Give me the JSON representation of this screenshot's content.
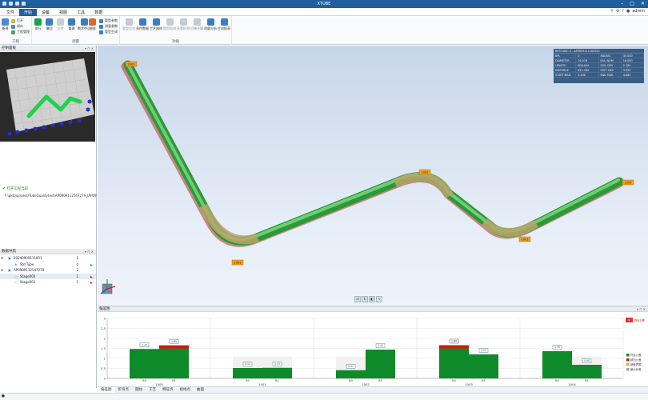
{
  "titlebar": {
    "title": "XTUBE"
  },
  "menu": {
    "tabs": [
      "文件",
      "开始",
      "设备",
      "视图",
      "工具",
      "数据"
    ],
    "active_index": 1,
    "user": "admin"
  },
  "ribbon": {
    "groups": [
      {
        "label": "工程"
      },
      {
        "label": "测量"
      },
      {
        "label": "功能"
      }
    ],
    "project": {
      "new": "新建",
      "open": "打开",
      "save": "保存",
      "manage": "工程管理"
    },
    "measure": {
      "run": "执行",
      "back": "撤回",
      "reverse": "反转",
      "rebuild": "重建",
      "fit_center": "数字中心",
      "view": "视图",
      "small": [
        "管型参数",
        "测量参数",
        "管型生成"
      ]
    },
    "functions": [
      "管型比对",
      "多件数据",
      "工艺路线",
      "管型检测",
      "多管检测",
      "回弹计算",
      "测量分析",
      "生成报表"
    ]
  },
  "left": {
    "preview_header": "控制面板",
    "project_name": "打开工程当前",
    "project_path": "F:\\pktp\\project\\TubeQualitytest\\AP0909112547279_IAP09",
    "tree_header": "数据导航",
    "tree": [
      {
        "label": "20240909111851",
        "count": "1",
        "level": 0,
        "icon": "folder-icon"
      },
      {
        "label": "Std Tube",
        "count": "0",
        "level": 1,
        "icon": "star-icon"
      },
      {
        "label": "AP0909112547279",
        "count": "2",
        "level": 0,
        "icon": "folder-icon"
      },
      {
        "label": "Stage000",
        "count": "1",
        "level": 1,
        "icon": "circle-icon"
      },
      {
        "label": "Stage001",
        "count": "1",
        "level": 1,
        "icon": "circle-icon"
      }
    ]
  },
  "viewport": {
    "labels": [
      "1000",
      "1001",
      "1002",
      "1003",
      "1004"
    ],
    "info": {
      "header": "BESTURE: 0 - AP0909111100912",
      "rows": [
        [
          "BPL",
          "0",
          "RADIUS",
          "30.000"
        ],
        [
          "DIAMETER",
          "16.078",
          "DIA. NOM",
          "16.000"
        ],
        [
          "LENGTH",
          "808.094",
          "LEN. DEV",
          "2.169"
        ],
        [
          "DISTANCE",
          "841.444",
          "DIST. DEV",
          "3.990"
        ],
        [
          "START MAR.",
          "1.406",
          "END MAR.",
          "4.682"
        ]
      ]
    }
  },
  "bottom": {
    "header": "偏差图",
    "legend": [
      "符合公差",
      "超出公差",
      "超差界限",
      "最大步差"
    ],
    "tabs": [
      "偏差图",
      "折弯点",
      "圆柱",
      "工艺",
      "特征点",
      "视线点",
      "曲面"
    ],
    "active_tab": 0
  },
  "chart_data": {
    "type": "bar",
    "yticks": [
      "3",
      "2.5",
      "2",
      "1.5",
      "1",
      "0.5",
      "0"
    ],
    "ylim": [
      0,
      3
    ],
    "groups": [
      {
        "name": "1000",
        "bars": [
          {
            "label": "B0",
            "value": 1.47,
            "text": "1.47",
            "exceed": 0
          },
          {
            "label": "B1",
            "value": 1.5,
            "text": "1.81",
            "exceed": 0.31
          }
        ]
      },
      {
        "name": "1001",
        "bars": [
          {
            "label": "B0",
            "value": 0.52,
            "text": "0.52",
            "exceed": 0
          },
          {
            "label": "B1",
            "value": 0.53,
            "text": "0.53",
            "exceed": 0
          }
        ]
      },
      {
        "name": "1002",
        "bars": [
          {
            "label": "B0",
            "value": 0.41,
            "text": "0.41",
            "exceed": 0
          },
          {
            "label": "B1",
            "value": 1.44,
            "text": "1.44",
            "exceed": 0
          }
        ]
      },
      {
        "name": "1003",
        "bars": [
          {
            "label": "B0",
            "value": 1.5,
            "text": "1.82",
            "exceed": 0.32
          },
          {
            "label": "B1",
            "value": 1.2,
            "text": "1.20",
            "exceed": 0
          }
        ]
      },
      {
        "name": "1004",
        "bars": [
          {
            "label": "B0",
            "value": 1.36,
            "text": "1.36",
            "exceed": 0
          },
          {
            "label": "B1",
            "value": 0.68,
            "text": "0.68",
            "exceed": 0
          }
        ]
      }
    ]
  },
  "colors": {
    "title": "#1f5f9e",
    "tube": "#3cb54a",
    "bend": "#b5a46a",
    "ok": "#0e8a2a",
    "bad": "#e01010",
    "panel": "#3b5d85"
  }
}
